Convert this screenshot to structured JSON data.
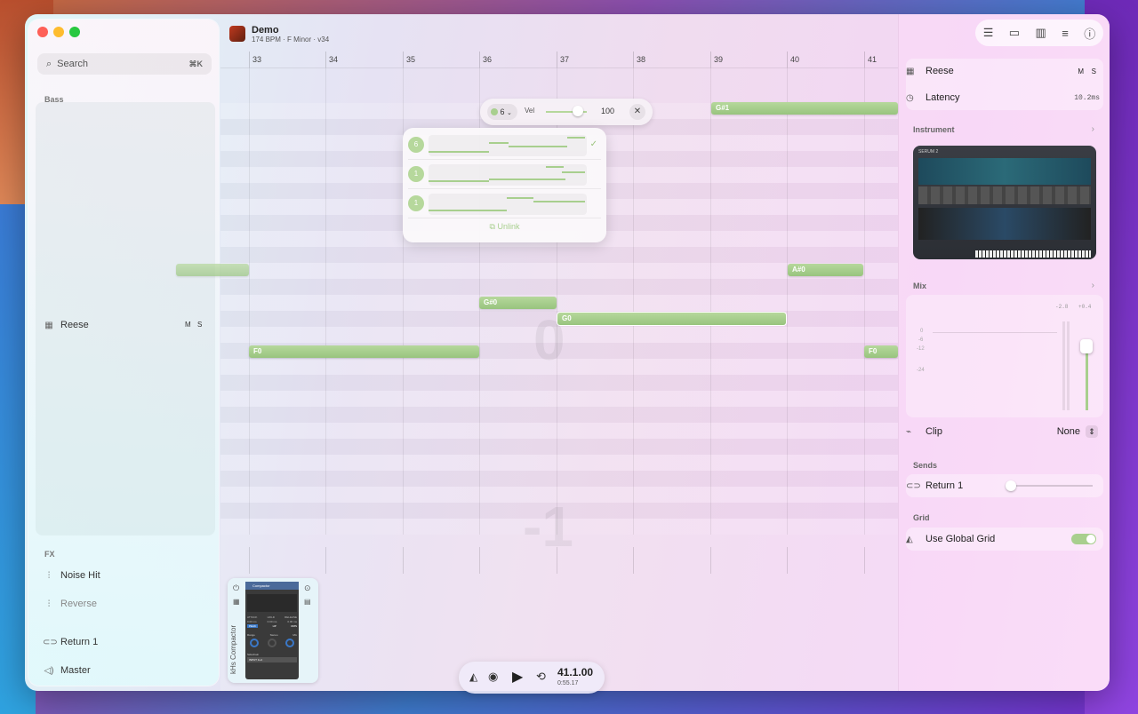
{
  "window": {
    "traffic_colors": [
      "#fe5f57",
      "#febc2e",
      "#28c840"
    ]
  },
  "sidebar": {
    "search": {
      "label": "Search",
      "shortcut": "⌘K"
    },
    "bass_label": "Bass",
    "bass_track": {
      "name": "Reese",
      "mute": "M",
      "solo": "S",
      "icon": "piano-icon"
    },
    "fx_label": "FX",
    "fx_items": [
      {
        "name": "Noise Hit",
        "icon": "waveform-icon"
      },
      {
        "name": "Reverse",
        "icon": "waveform-icon"
      }
    ],
    "returns": [
      {
        "name": "Return 1",
        "icon": "return-icon"
      }
    ],
    "master": {
      "name": "Master",
      "icon": "speaker-icon"
    }
  },
  "project": {
    "title": "Demo",
    "subtitle": "174 BPM · F Minor · v34"
  },
  "ruler": [
    "33",
    "34",
    "35",
    "36",
    "37",
    "38",
    "39",
    "40",
    "41"
  ],
  "velocity": {
    "pattern_number": "6",
    "vel_label": "Vel",
    "value": "100"
  },
  "patterns": [
    {
      "number": "6",
      "selected": true
    },
    {
      "number": "1",
      "selected": false
    },
    {
      "number": "1",
      "selected": false
    }
  ],
  "unlink_label": "Unlink",
  "notes": [
    "G#1",
    "A#0",
    "G#0",
    "G0",
    "F0",
    "F0"
  ],
  "watermarks": [
    "0",
    "-1"
  ],
  "inspector": {
    "track": {
      "name": "Reese",
      "mute": "M",
      "solo": "S"
    },
    "latency": {
      "label": "Latency",
      "value": "10.2ms"
    },
    "instrument_label": "Instrument",
    "synth_name": "SERUM 2",
    "mix_label": "Mix",
    "meter_values": [
      "-2.8",
      "+0.4"
    ],
    "scale": [
      "0",
      "-6",
      "-12",
      "-24"
    ],
    "clip": {
      "label": "Clip",
      "value": "None"
    },
    "sends_label": "Sends",
    "send": {
      "name": "Return 1"
    },
    "grid_label": "Grid",
    "global_grid": {
      "label": "Use Global Grid",
      "enabled": true
    }
  },
  "plugin": {
    "name": "kHs Compactor",
    "title": "Compactor",
    "attack": "ATTACK",
    "hold": "HOLD",
    "release": "RELEASE",
    "attack_val": "0.00 ms",
    "hold_val": "0.00 ms",
    "release_val": "0.00 ms",
    "mode1": "PEAK",
    "mode2": "HP",
    "mode3": "RMS",
    "range": "Range",
    "stereo": "Stereo",
    "mix": "Mix",
    "sidechain": "Sidechain",
    "input": "INPUT 3+4"
  },
  "transport": {
    "position": "41.1.00",
    "time": "0:55.17"
  }
}
